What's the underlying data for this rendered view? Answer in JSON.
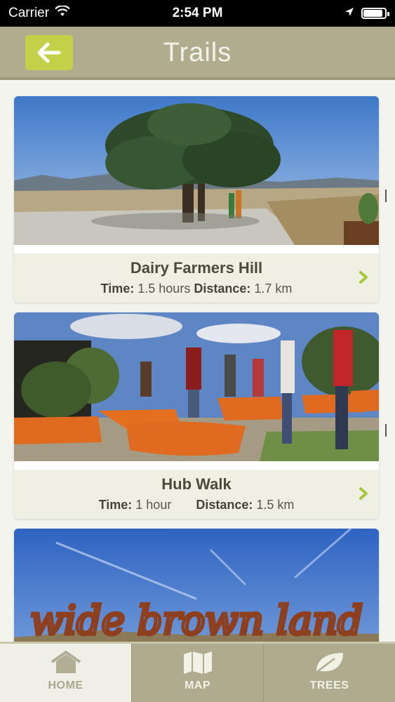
{
  "status_bar": {
    "carrier": "Carrier",
    "time": "2:54 PM",
    "battery_level": 0.9
  },
  "nav": {
    "title": "Trails",
    "back_icon": "arrow-left-icon",
    "accent": "#c2d148"
  },
  "trails": [
    {
      "name": "Dairy Farmers Hill",
      "time_label": "Time:",
      "time_value": "1.5 hours",
      "distance_label": "Distance:",
      "distance_value": "1.7 km",
      "image": "hilltop tree with hikers"
    },
    {
      "name": "Hub Walk",
      "time_label": "Time:",
      "time_value": "1 hour",
      "distance_label": "Distance:",
      "distance_value": "1.5 km",
      "image": "garden with orange planters and visitors"
    },
    {
      "image": "rusted metal lettering sculpture"
    }
  ],
  "sculpture_text": "wide brown land",
  "tabs": [
    {
      "label": "HOME",
      "icon": "home-icon",
      "active": true
    },
    {
      "label": "MAP",
      "icon": "map-icon",
      "active": false
    },
    {
      "label": "TREES",
      "icon": "leaf-icon",
      "active": false
    }
  ]
}
